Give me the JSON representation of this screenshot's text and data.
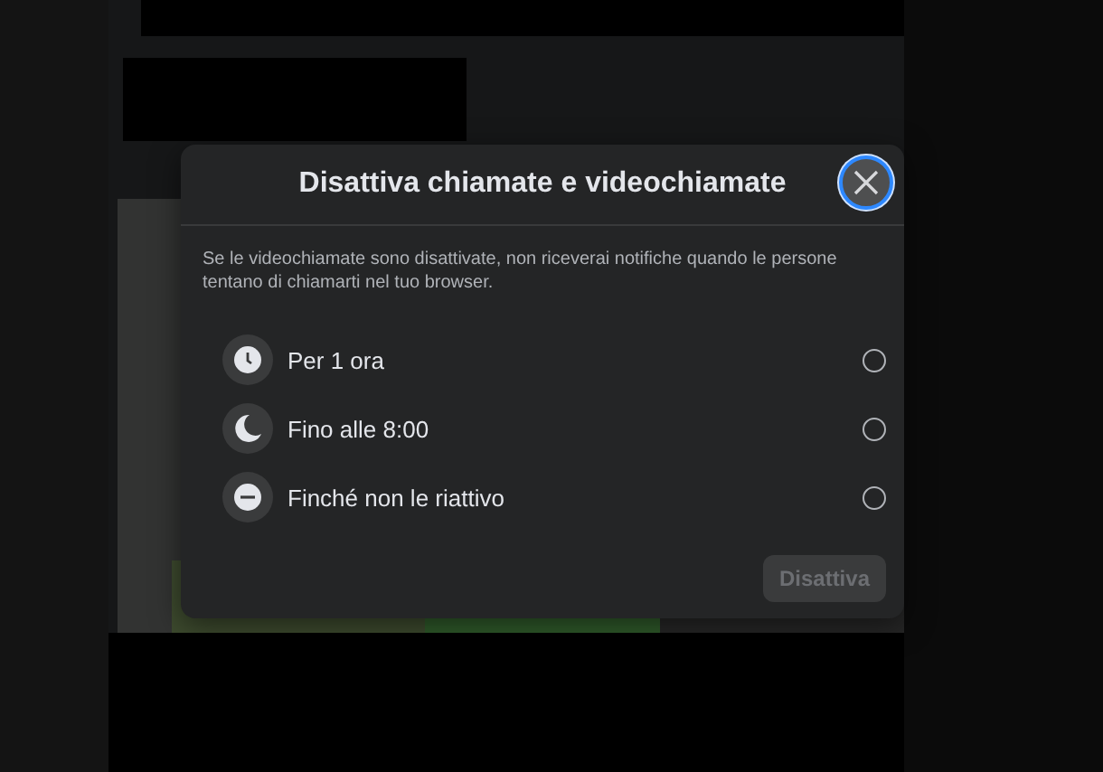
{
  "dialog": {
    "title": "Disattiva chiamate e videochiamate",
    "description": "Se le videochiamate sono disattivate, non riceverai notifiche quando le persone tentano di chiamarti nel tuo browser.",
    "options": [
      {
        "label": "Per 1 ora",
        "selected": false
      },
      {
        "label": "Fino alle 8:00",
        "selected": false
      },
      {
        "label": "Finché non le riattivo",
        "selected": false
      }
    ],
    "confirm_button": {
      "label": "Disattiva",
      "disabled": true
    }
  }
}
